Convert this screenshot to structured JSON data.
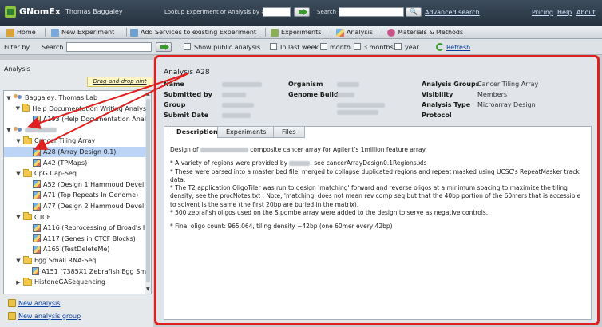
{
  "header": {
    "app_title": "GNomEx",
    "user_name": "Thomas Baggaley",
    "lookup_label": "Lookup Experiment or Analysis by #",
    "search_label": "Search",
    "advanced_search": "Advanced search",
    "links": [
      "Pricing",
      "Help",
      "About"
    ]
  },
  "nav": {
    "items": [
      "Home",
      "New Experiment",
      "Add Services to existing Experiment",
      "Experiments",
      "Analysis",
      "Materials & Methods"
    ]
  },
  "filter": {
    "filter_by": "Filter by",
    "search": "Search",
    "show_public": "Show public analysis",
    "in_last_week": "In last week",
    "month": "month",
    "three_months": "3 months",
    "year": "year",
    "refresh": "Refresh"
  },
  "left_panel": {
    "title": "Analysis",
    "drag_hint": "Drag-and-drop hint",
    "tree": [
      {
        "label": "Baggaley, Thomas Lab",
        "level": 0,
        "type": "lab",
        "expanded": true
      },
      {
        "label": "Help Documentation Writing Analys",
        "level": 1,
        "type": "folder",
        "expanded": true
      },
      {
        "label": "A193 (Help Documentation Anal",
        "level": 2,
        "type": "analysis"
      },
      {
        "label": "",
        "level": 0,
        "type": "lab",
        "expanded": true,
        "redacted": true
      },
      {
        "label": "Cancer Tiling Array",
        "level": 1,
        "type": "folder",
        "expanded": true
      },
      {
        "label": "A28 (Array Design 0.1)",
        "level": 2,
        "type": "analysis",
        "selected": true
      },
      {
        "label": "A42 (TPMaps)",
        "level": 2,
        "type": "analysis"
      },
      {
        "label": "CpG Cap-Seq",
        "level": 1,
        "type": "folder",
        "expanded": true
      },
      {
        "label": "A52 (Design 1 Hammoud Devel",
        "level": 2,
        "type": "analysis"
      },
      {
        "label": "A71 (Top Repeats In Genome)",
        "level": 2,
        "type": "analysis"
      },
      {
        "label": "A77 (Design 2 Hammoud Devel",
        "level": 2,
        "type": "analysis"
      },
      {
        "label": "CTCF",
        "level": 1,
        "type": "folder",
        "expanded": true
      },
      {
        "label": "A116 (Reprocessing of Broad's I",
        "level": 2,
        "type": "analysis"
      },
      {
        "label": "A117 (Genes in CTCF Blocks)",
        "level": 2,
        "type": "analysis"
      },
      {
        "label": "A165 (TestDeleteMe)",
        "level": 2,
        "type": "analysis"
      },
      {
        "label": "Egg Small RNA-Seq",
        "level": 1,
        "type": "folder",
        "expanded": true
      },
      {
        "label": "A151 (7385X1 Zebrafish Egg Sm",
        "level": 2,
        "type": "analysis"
      },
      {
        "label": "HistoneGASequencing",
        "level": 1,
        "type": "folder",
        "expanded": false
      }
    ],
    "new_analysis": "New analysis",
    "new_analysis_group": "New analysis group"
  },
  "main": {
    "analysis_title": "Analysis A28",
    "labels": {
      "name": "Name",
      "submitted_by": "Submitted by",
      "group": "Group",
      "submit_date": "Submit Date",
      "organism": "Organism",
      "genome_build": "Genome Build",
      "analysis_groups": "Analysis Groups",
      "visibility": "Visibility",
      "analysis_type": "Analysis Type",
      "protocol": "Protocol"
    },
    "values": {
      "analysis_groups": "Cancer Tiling Array",
      "visibility": "Members",
      "analysis_type": "Microarray Design"
    },
    "tabs": [
      "Description",
      "Experiments",
      "Files"
    ],
    "description": {
      "line1_a": "Design of",
      "line1_b": "composite cancer array for Agilent's 1million feature array",
      "line2_a": "* A variety of regions were provided by",
      "line2_b": ", see cancerArrayDesign0.1Regions.xls",
      "line3": "* These were parsed into a master bed file, merged to collapse duplicated regions and repeat masked using UCSC's RepeatMasker track data.",
      "line4": "* The T2 application OligoTiler was run to design 'matching' forward and reverse oligos at a minimum spacing to maximize the tiling density, see the procNotes.txt . Note, 'matching' does not mean rev comp seq but that the 40bp portion of the 60mers that is accessible to solvent is the same (the first 20bp are buried in the matrix).",
      "line5": "* 500 zebrafish oligos used on the S.pombe array were added to the design to serve as negative controls.",
      "line6": "* Final oligo count: 965,064, tiling density ~42bp (one 60mer every 42bp)"
    }
  },
  "colors": {
    "highlight_red": "#e02020",
    "selected_row": "#bcd4f6",
    "header_bg": "#2f3c49",
    "link_blue": "#0a3fa0"
  }
}
